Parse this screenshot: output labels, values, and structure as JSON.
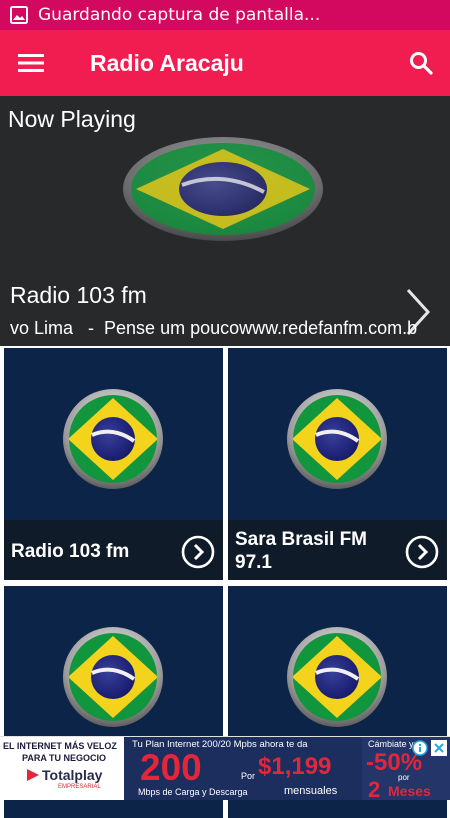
{
  "status_bar": {
    "notification_text": "Guardando captura de pantalla..."
  },
  "app_bar": {
    "title": "Radio Aracaju"
  },
  "now_playing": {
    "label": "Now Playing",
    "station": "Radio 103 fm",
    "ticker": "vo Lima   -  Pense um poucowww.redefanfm.com.b"
  },
  "stations": [
    {
      "name": "Radio 103 fm"
    },
    {
      "name": "Sara Brasil FM 97.1"
    },
    {
      "name": ""
    },
    {
      "name": ""
    }
  ],
  "ad": {
    "left_line1": "EL INTERNET MÁS VELOZ",
    "left_line2": "PARA TU NEGOCIO",
    "brand": "Totalplay",
    "brand_sub": "EMPRESARIAL",
    "plan_line": "Tu Plan Internet 200/20 Mpbs ahora te da",
    "speed": "200",
    "speed_unit": "Mbps de Carga y Descarga",
    "por": "Por",
    "price": "$1,199",
    "price_unit": "mensuales",
    "promo_top": "Cámbiate ya",
    "discount": "-50%",
    "discount_por": "por",
    "months": "2",
    "months_label": "Meses"
  },
  "colors": {
    "status_bar": "#d3085f",
    "app_bar": "#f11c4f",
    "now_playing_bg": "#27292b",
    "card_bg": "#0b2448",
    "ad_accent": "#e3263a"
  }
}
